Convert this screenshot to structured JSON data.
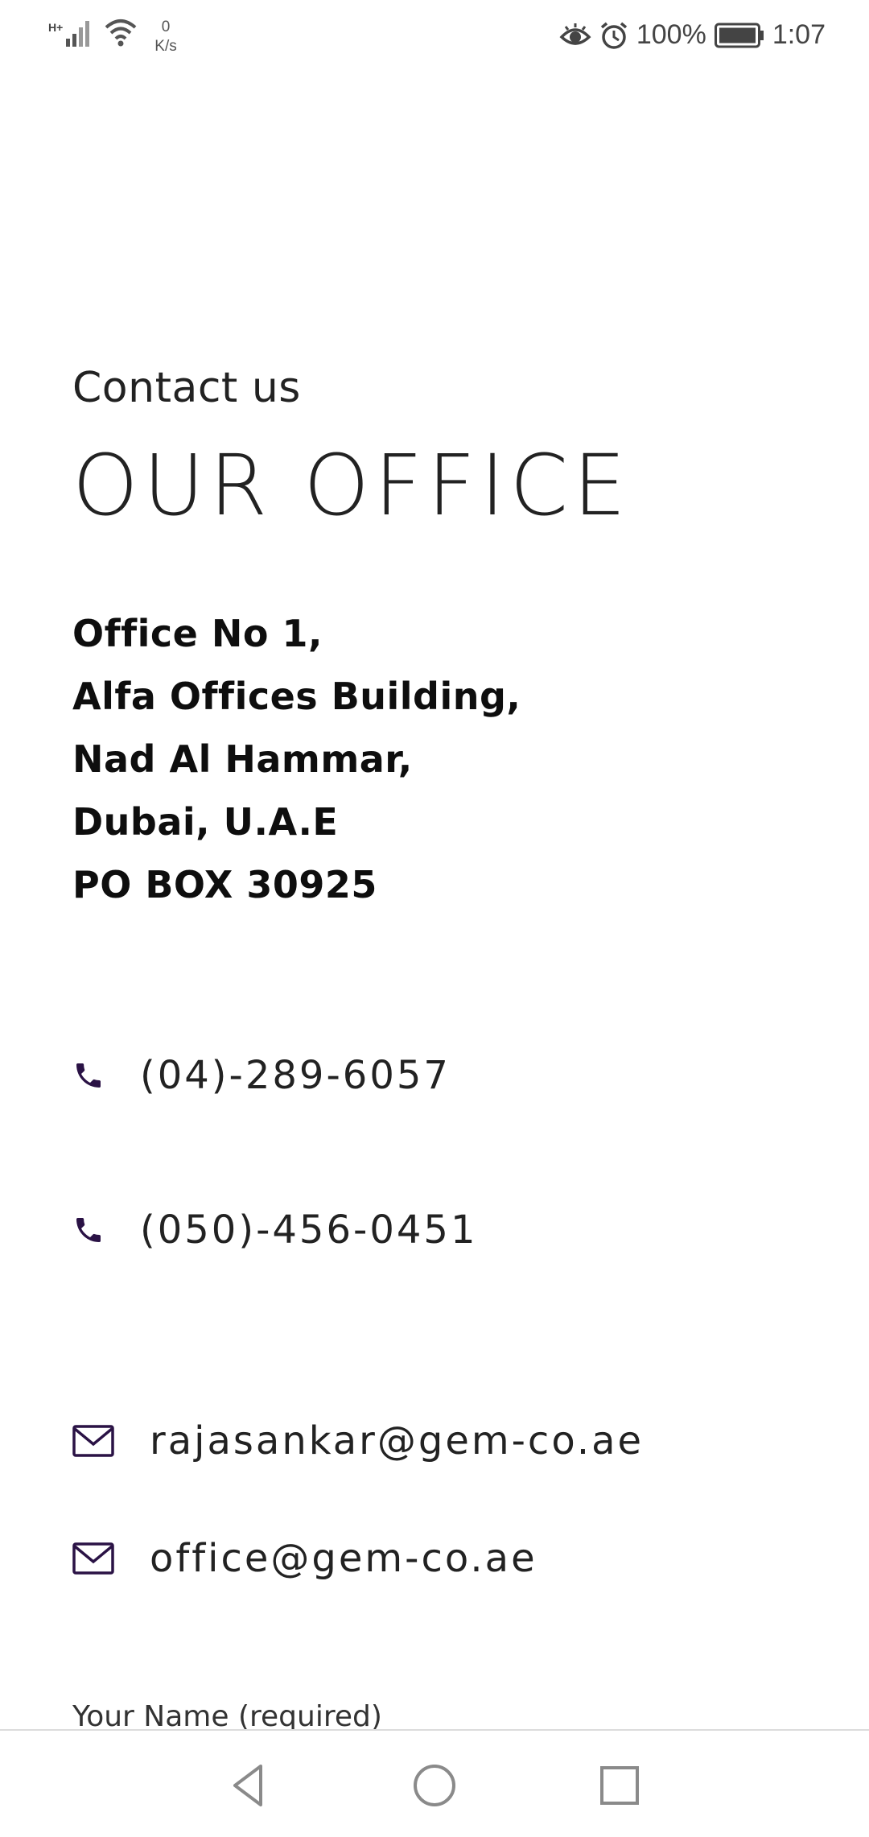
{
  "status_bar": {
    "network_type": "H+",
    "net_speed_value": "0",
    "net_speed_unit": "K/s",
    "battery": "100%",
    "time": "1:07"
  },
  "page": {
    "contact_label": "Contact us",
    "office_title": "OUR OFFICE",
    "address_lines": [
      "Office No 1,",
      "Alfa Offices Building,",
      "Nad Al Hammar,",
      "Dubai, U.A.E",
      "PO BOX 30925"
    ],
    "phones": [
      "(04)-289-6057",
      "(050)-456-0451"
    ],
    "emails": [
      "rajasankar@gem-co.ae",
      "office@gem-co.ae"
    ],
    "form_name_label": "Your Name (required)"
  },
  "colors": {
    "icon_accent": "#2a1245",
    "text": "#1f1f1f"
  },
  "icons": {
    "phone": "phone-icon",
    "email": "envelope-icon",
    "nav_back": "back-triangle-icon",
    "nav_home": "home-circle-icon",
    "nav_recents": "recents-square-icon"
  }
}
